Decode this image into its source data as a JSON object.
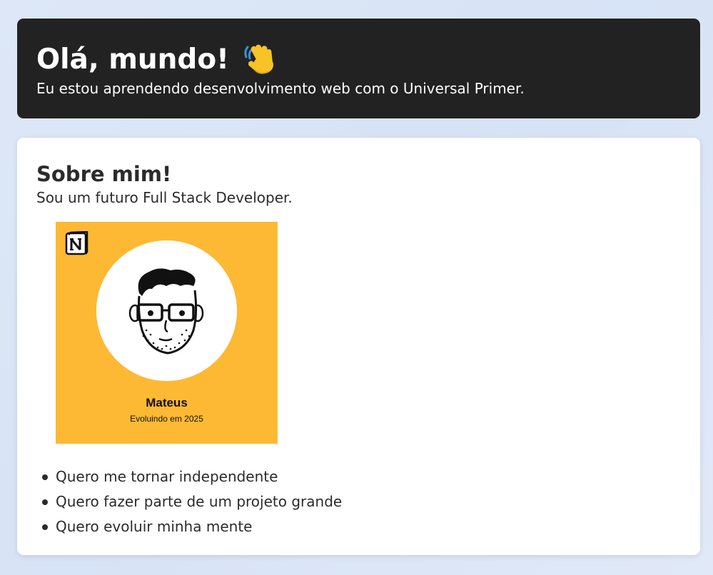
{
  "header": {
    "title": "Olá, mundo!",
    "subtitle": "Eu estou aprendendo desenvolvimento web com o Universal Primer."
  },
  "about": {
    "heading": "Sobre mim!",
    "text": "Sou um futuro Full Stack Developer.",
    "avatar": {
      "name": "Mateus",
      "tagline": "Evoluindo em 2025",
      "background_color": "#fdb933",
      "logo_icon": "notion-logo-icon"
    },
    "goals": [
      "Quero me tornar independente",
      "Quero fazer parte de um projeto grande",
      "Quero evoluir minha mente"
    ]
  },
  "colors": {
    "header_bg": "#222222",
    "card_bg": "#ffffff",
    "page_bg": "#dde7f7"
  }
}
